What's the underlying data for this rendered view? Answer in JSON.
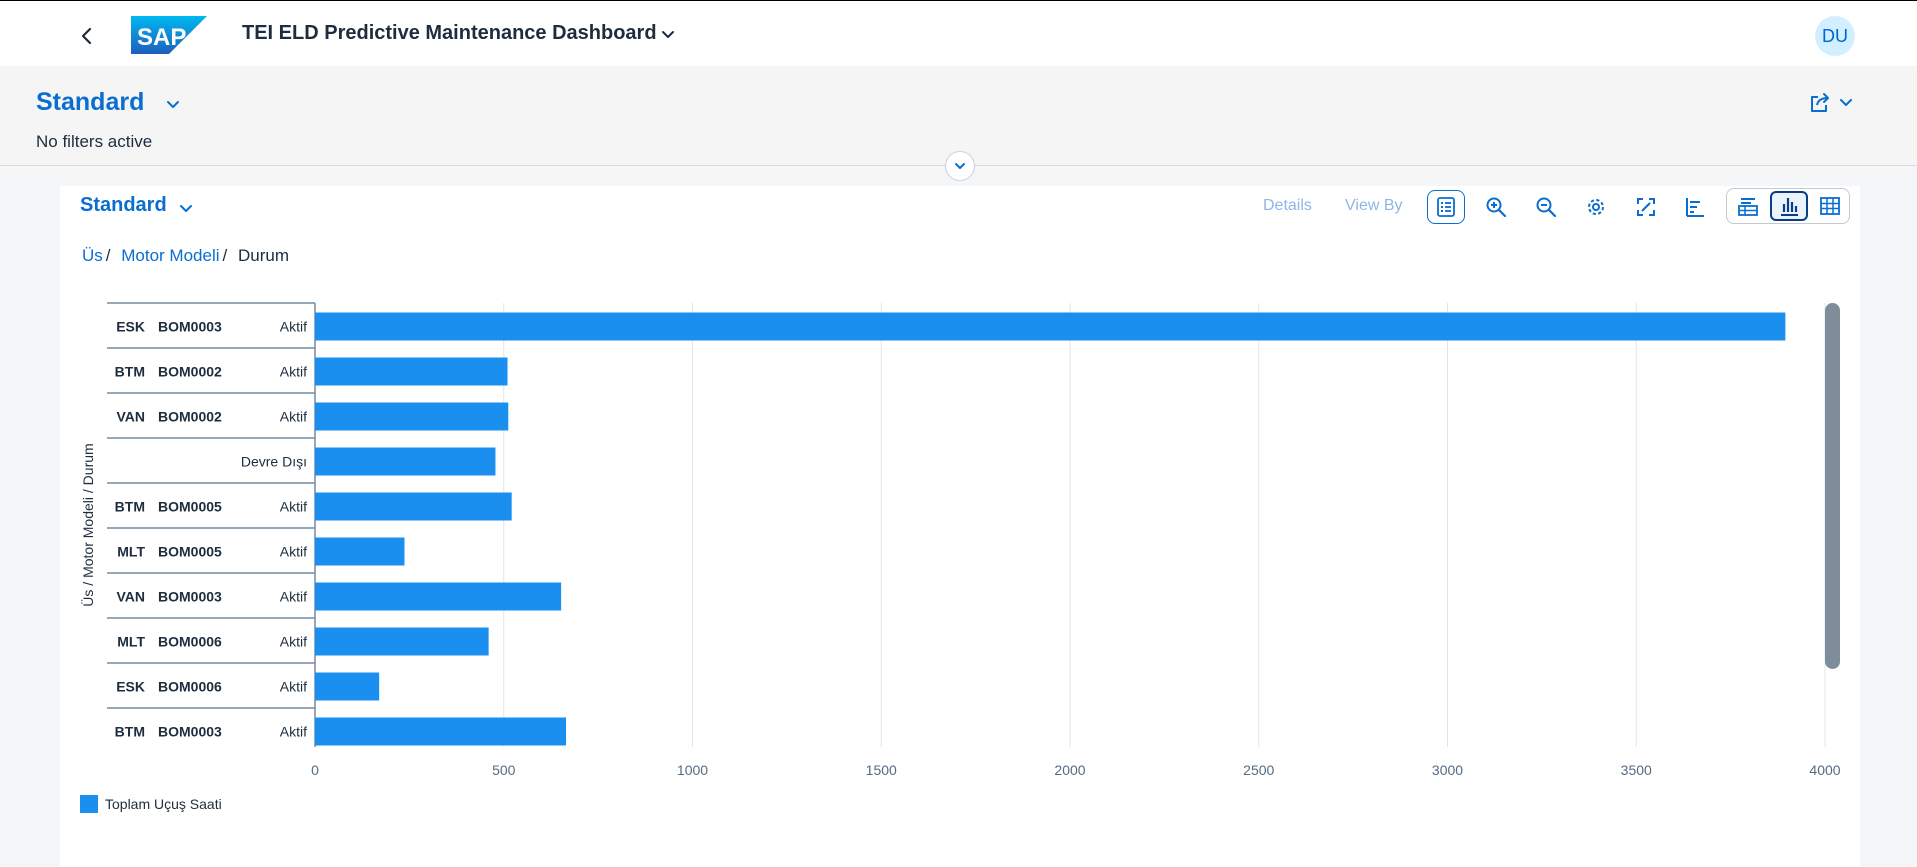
{
  "shell": {
    "logo_text": "SAP",
    "title": "TEI ELD Predictive Maintenance Dashboard",
    "avatar_initials": "DU"
  },
  "header": {
    "variant": "Standard",
    "filter_status": "No filters active"
  },
  "card": {
    "variant": "Standard",
    "toolbar": {
      "details_label": "Details",
      "view_by_label": "View By"
    },
    "breadcrumb": {
      "items": [
        "Üs",
        "Motor Modeli"
      ],
      "current": "Durum",
      "separator": "/"
    }
  },
  "colors": {
    "bar": "#1b8ff0",
    "accent": "#0a6ed1"
  },
  "chart_data": {
    "type": "bar",
    "orientation": "horizontal",
    "ylabel": "Üs / Motor Modeli / Durum",
    "xlim": [
      0,
      4000
    ],
    "x_ticks": [
      "0",
      "500",
      "1000",
      "1500",
      "2000",
      "2500",
      "3000",
      "3500",
      "4000"
    ],
    "grid": true,
    "legend_position": "bottom-left",
    "categories": [
      {
        "us": "ESK",
        "model": "BOM0003",
        "durum": "Aktif"
      },
      {
        "us": "BTM",
        "model": "BOM0002",
        "durum": "Aktif"
      },
      {
        "us": "VAN",
        "model": "BOM0002",
        "durum": "Aktif"
      },
      {
        "us": "",
        "model": "",
        "durum": "Devre Dışı"
      },
      {
        "us": "BTM",
        "model": "BOM0005",
        "durum": "Aktif"
      },
      {
        "us": "MLT",
        "model": "BOM0005",
        "durum": "Aktif"
      },
      {
        "us": "VAN",
        "model": "BOM0003",
        "durum": "Aktif"
      },
      {
        "us": "MLT",
        "model": "BOM0006",
        "durum": "Aktif"
      },
      {
        "us": "ESK",
        "model": "BOM0006",
        "durum": "Aktif"
      },
      {
        "us": "BTM",
        "model": "BOM0003",
        "durum": "Aktif"
      }
    ],
    "series": [
      {
        "name": "Toplam Uçuş Saati",
        "values": [
          3895,
          510,
          512,
          478,
          521,
          237,
          652,
          460,
          170,
          665
        ]
      }
    ]
  }
}
